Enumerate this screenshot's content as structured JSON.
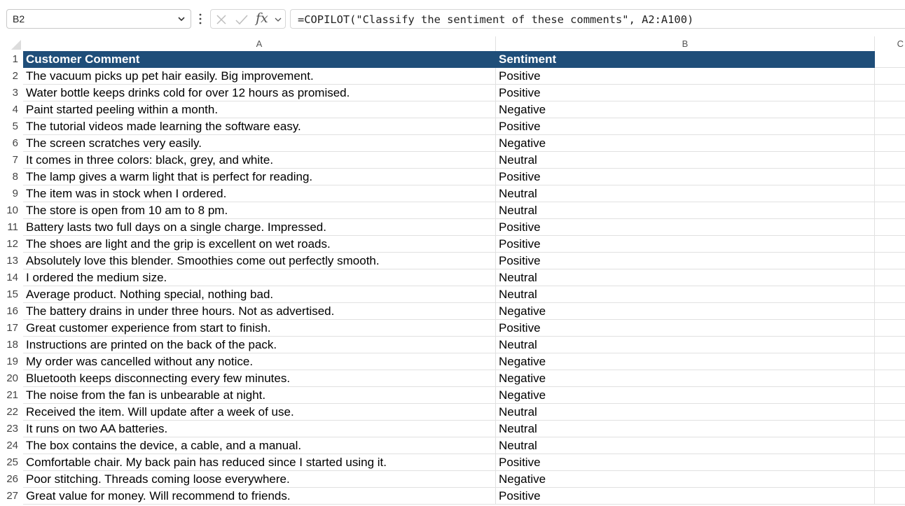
{
  "formula_bar": {
    "name_box": "B2",
    "fx_label": "fx",
    "formula": "=COPILOT(\"Classify the sentiment of these comments\", A2:A100)"
  },
  "columns": [
    "A",
    "B",
    "C"
  ],
  "header": {
    "col_a": "Customer Comment",
    "col_b": "Sentiment"
  },
  "colors": {
    "header_bg": "#1f4e79",
    "header_text": "#ffffff",
    "gridline": "#e1e1e1"
  },
  "rows": [
    {
      "n": "1"
    },
    {
      "n": "2",
      "comment": "The vacuum picks up pet hair easily. Big improvement.",
      "sentiment": "Positive"
    },
    {
      "n": "3",
      "comment": "Water bottle keeps drinks cold for over 12 hours as promised.",
      "sentiment": "Positive"
    },
    {
      "n": "4",
      "comment": "Paint started peeling within a month.",
      "sentiment": "Negative"
    },
    {
      "n": "5",
      "comment": "The tutorial videos made learning the software easy.",
      "sentiment": "Positive"
    },
    {
      "n": "6",
      "comment": "The screen scratches very easily.",
      "sentiment": "Negative"
    },
    {
      "n": "7",
      "comment": "It comes in three colors: black, grey, and white.",
      "sentiment": "Neutral"
    },
    {
      "n": "8",
      "comment": "The lamp gives a warm light that is perfect for reading.",
      "sentiment": "Positive"
    },
    {
      "n": "9",
      "comment": "The item was in stock when I ordered.",
      "sentiment": "Neutral"
    },
    {
      "n": "10",
      "comment": "The store is open from 10 am to 8 pm.",
      "sentiment": "Neutral"
    },
    {
      "n": "11",
      "comment": "Battery lasts two full days on a single charge. Impressed.",
      "sentiment": "Positive"
    },
    {
      "n": "12",
      "comment": "The shoes are light and the grip is excellent on wet roads.",
      "sentiment": "Positive"
    },
    {
      "n": "13",
      "comment": "Absolutely love this blender. Smoothies come out perfectly smooth.",
      "sentiment": "Positive"
    },
    {
      "n": "14",
      "comment": "I ordered the medium size.",
      "sentiment": "Neutral"
    },
    {
      "n": "15",
      "comment": "Average product. Nothing special, nothing bad.",
      "sentiment": "Neutral"
    },
    {
      "n": "16",
      "comment": "The battery drains in under three hours. Not as advertised.",
      "sentiment": "Negative"
    },
    {
      "n": "17",
      "comment": "Great customer experience from start to finish.",
      "sentiment": "Positive"
    },
    {
      "n": "18",
      "comment": "Instructions are printed on the back of the pack.",
      "sentiment": "Neutral"
    },
    {
      "n": "19",
      "comment": "My order was cancelled without any notice.",
      "sentiment": "Negative"
    },
    {
      "n": "20",
      "comment": "Bluetooth keeps disconnecting every few minutes.",
      "sentiment": "Negative"
    },
    {
      "n": "21",
      "comment": "The noise from the fan is unbearable at night.",
      "sentiment": "Negative"
    },
    {
      "n": "22",
      "comment": "Received the item. Will update after a week of use.",
      "sentiment": "Neutral"
    },
    {
      "n": "23",
      "comment": "It runs on two AA batteries.",
      "sentiment": "Neutral"
    },
    {
      "n": "24",
      "comment": "The box contains the device, a cable, and a manual.",
      "sentiment": "Neutral"
    },
    {
      "n": "25",
      "comment": "Comfortable chair. My back pain has reduced since I started using it.",
      "sentiment": "Positive"
    },
    {
      "n": "26",
      "comment": "Poor stitching. Threads coming loose everywhere.",
      "sentiment": "Negative"
    },
    {
      "n": "27",
      "comment": "Great value for money. Will recommend to friends.",
      "sentiment": "Positive"
    }
  ]
}
